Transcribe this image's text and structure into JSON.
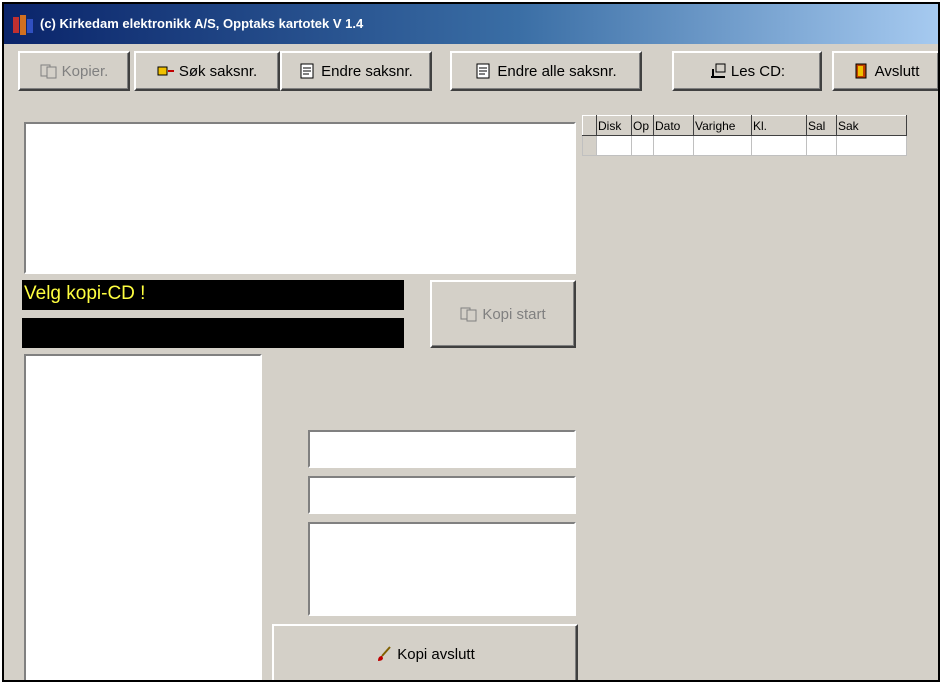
{
  "window": {
    "title": "(c) Kirkedam elektronikk A/S, Opptaks kartotek V 1.4"
  },
  "toolbar": {
    "kopier": "Kopier.",
    "sok": "Søk saksnr.",
    "endre": "Endre saksnr.",
    "endre_alle": "Endre alle saksnr.",
    "les_cd": "Les CD:",
    "avslutt": "Avslutt"
  },
  "status": {
    "message": "Velg kopi-CD !",
    "secondary": ""
  },
  "buttons": {
    "kopi_start": "Kopi start",
    "kopi_avslutt": "Kopi avslutt"
  },
  "table": {
    "columns": [
      "Disk",
      "Op",
      "Dato",
      "Varighe",
      "Kl.",
      "Sal",
      "Sak"
    ]
  },
  "icons": {
    "app": "app-logo-icon",
    "copy": "copy-icon",
    "search": "search-icon",
    "edit": "edit-icon",
    "cd": "cd-icon",
    "exit": "exit-door-icon",
    "brush": "brush-icon"
  }
}
